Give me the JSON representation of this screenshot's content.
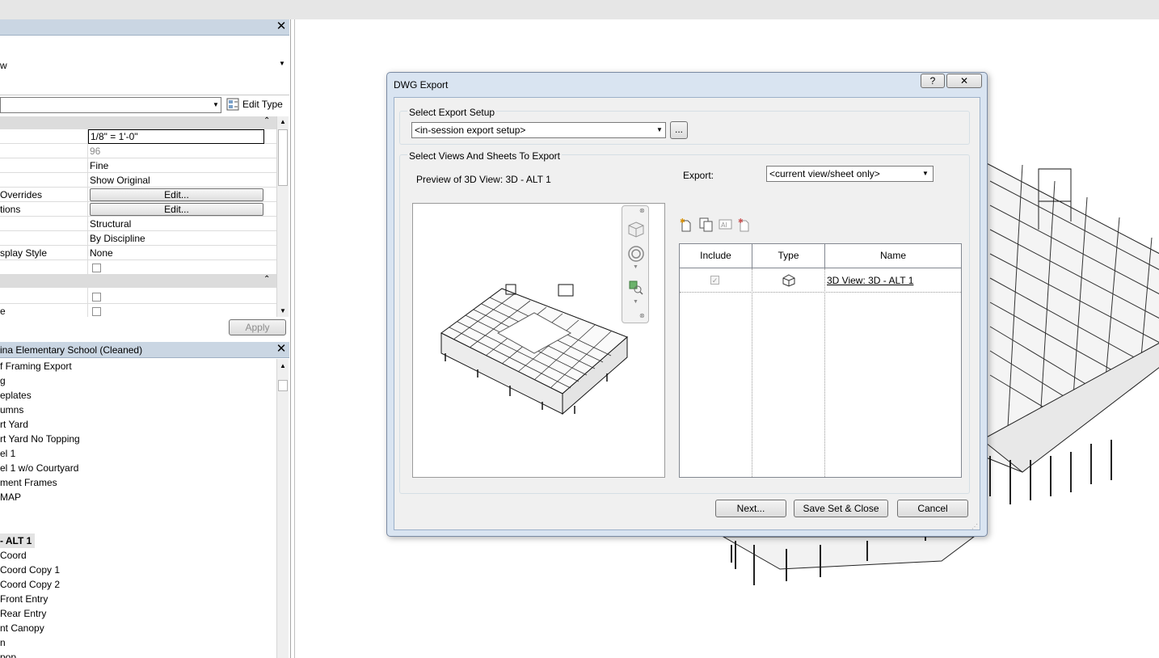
{
  "properties": {
    "type_label": "Edit Type",
    "view_type_fragment": "w",
    "rows": [
      {
        "name": "",
        "value": "1/8\" = 1'-0\""
      },
      {
        "name": "",
        "value": "96"
      },
      {
        "name": "",
        "value": "Fine"
      },
      {
        "name": "",
        "value": "Show Original"
      },
      {
        "name": "Overrides",
        "value": "Edit..."
      },
      {
        "name": "tions",
        "value": "Edit..."
      },
      {
        "name": "",
        "value": "Structural"
      },
      {
        "name": "",
        "value": "By Discipline"
      },
      {
        "name": "splay Style",
        "value": "None"
      }
    ],
    "row_after_group_2": "e",
    "apply_label": "Apply"
  },
  "browser": {
    "title": "ina Elementary School (Cleaned)",
    "items": [
      "f Framing Export",
      "g",
      "eplates",
      "umns",
      "rt Yard",
      "rt Yard No Topping",
      "el 1",
      "el 1 w/o Courtyard",
      "ment Frames",
      "MAP",
      "",
      "- ALT 1",
      "Coord",
      "Coord Copy 1",
      "Coord Copy 2",
      "Front Entry",
      "Rear Entry",
      "nt Canopy",
      "n",
      "pop"
    ]
  },
  "dialog": {
    "title": "DWG Export",
    "help_label": "?",
    "close_label": "✕",
    "setup_group": "Select Export Setup",
    "setup_value": "<in-session export setup>",
    "more_label": "...",
    "views_group": "Select Views And Sheets To Export",
    "preview_label": "Preview of 3D View: 3D - ALT 1",
    "export_label": "Export:",
    "export_value": "<current view/sheet only>",
    "columns": [
      "Include",
      "Type",
      "Name"
    ],
    "rows": [
      {
        "include": true,
        "type_icon": "3d-view-icon",
        "name": "3D View: 3D - ALT 1"
      }
    ],
    "buttons": {
      "next": "Next...",
      "save": "Save Set & Close",
      "cancel": "Cancel"
    }
  },
  "colors": {
    "panel_header": "#cad6e3",
    "dialog_frame": "#d9e4f1",
    "dialog_client": "#f0f0f0"
  }
}
